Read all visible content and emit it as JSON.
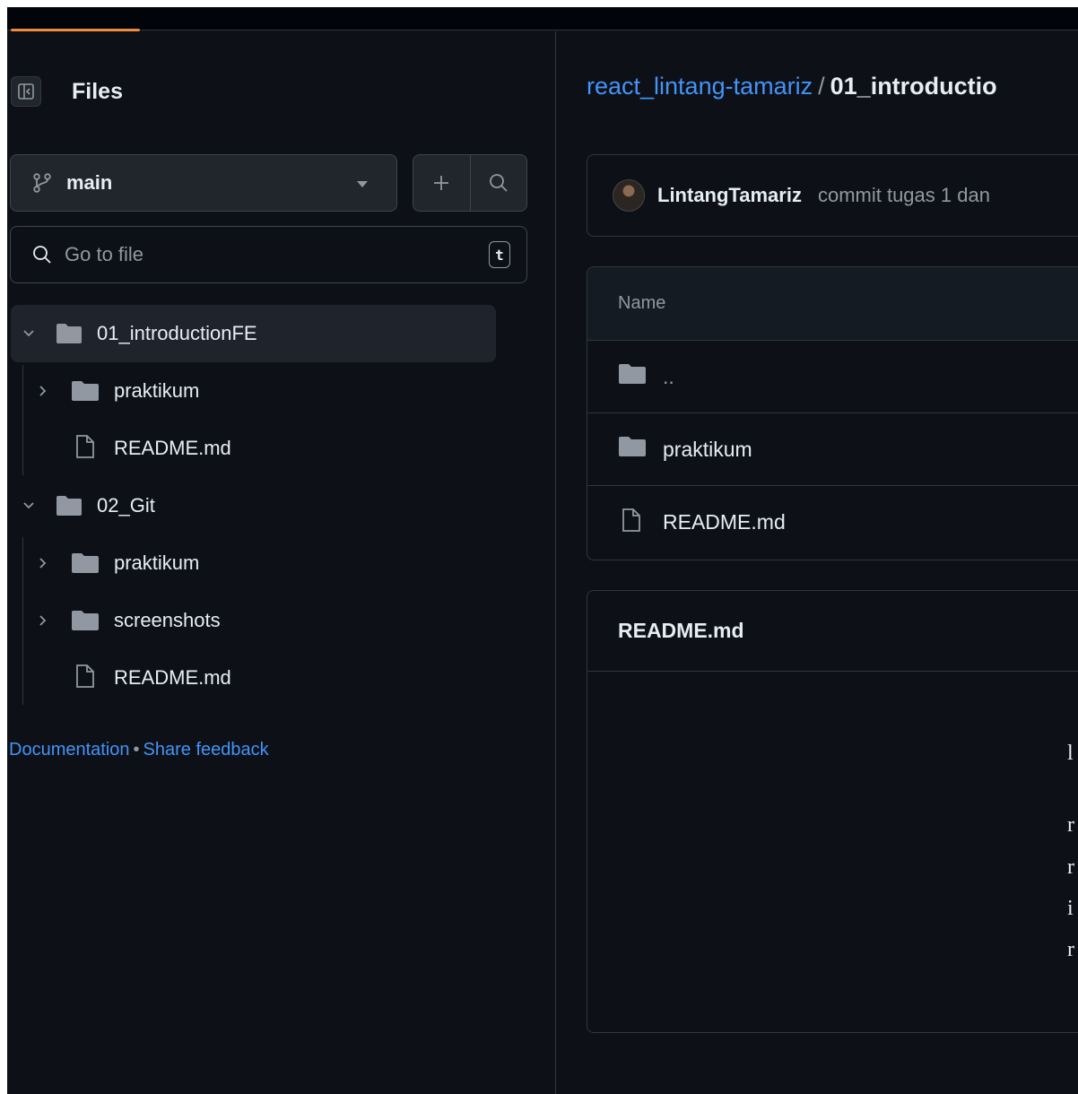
{
  "sidebar": {
    "title": "Files",
    "branch": "main",
    "search_placeholder": "Go to file",
    "search_shortcut": "t",
    "tree": [
      {
        "label": "01_introductionFE",
        "type": "folder",
        "expanded": true,
        "active": true
      },
      {
        "label": "praktikum",
        "type": "folder",
        "expanded": false
      },
      {
        "label": "README.md",
        "type": "file"
      },
      {
        "label": "02_Git",
        "type": "folder",
        "expanded": true
      },
      {
        "label": "praktikum",
        "type": "folder",
        "expanded": false
      },
      {
        "label": "screenshots",
        "type": "folder",
        "expanded": false
      },
      {
        "label": "README.md",
        "type": "file"
      }
    ],
    "footer": {
      "documentation": "Documentation",
      "separator": "•",
      "feedback": "Share feedback"
    }
  },
  "breadcrumb": {
    "repo": "react_lintang-tamariz",
    "separator": "/",
    "current": "01_introductio"
  },
  "commit": {
    "author": "LintangTamariz",
    "message": "commit tugas 1 dan"
  },
  "file_table": {
    "header": "Name",
    "rows": [
      {
        "label": "..",
        "type": "folder"
      },
      {
        "label": "praktikum",
        "type": "folder"
      },
      {
        "label": "README.md",
        "type": "file"
      }
    ]
  },
  "readme": {
    "title": "README.md",
    "lines": [
      "l",
      "r",
      "r",
      "i",
      "r"
    ]
  },
  "colors": {
    "accent_link": "#4493f8",
    "background": "#0d1117",
    "border": "#30363d",
    "loading_bar": "#f0883e"
  }
}
